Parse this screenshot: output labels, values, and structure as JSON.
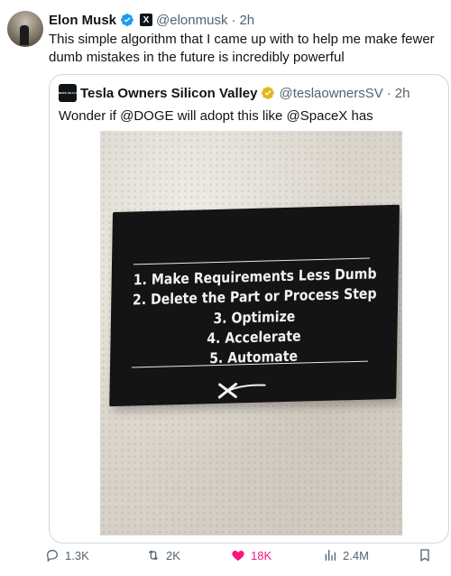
{
  "tweet": {
    "author_name": "Elon Musk",
    "handle": "@elonmusk",
    "separator": "·",
    "time": "2h",
    "text": "This simple algorithm that I came up with to help me make fewer dumb mistakes in the future is incredibly powerful"
  },
  "quote": {
    "author_name": "Tesla Owners Silicon Valley",
    "handle": "@teslaownersSV",
    "separator": "·",
    "time": "2h",
    "text": "Wonder if @DOGE will adopt this like @SpaceX has",
    "avatar_text": "TESLA OWNERS SILICON VALLEY"
  },
  "image": {
    "sign_lines": [
      "1. Make Requirements Less Dumb",
      "2. Delete the Part or Process Step",
      "3. Optimize",
      "4. Accelerate",
      "5. Automate"
    ]
  },
  "actions": {
    "replies": "1.3K",
    "reposts": "2K",
    "likes": "18K",
    "views": "2.4M"
  },
  "colors": {
    "verified_blue": "#1d9bf0",
    "verified_gold": "#e2b719",
    "like_pink": "#f91880",
    "secondary_text": "#536471"
  }
}
